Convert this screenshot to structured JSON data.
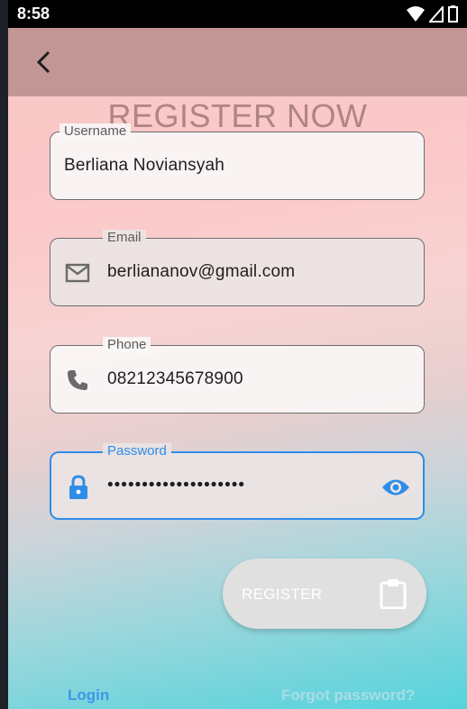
{
  "status_bar": {
    "time": "8:58",
    "icons": [
      "wifi-icon",
      "signal-icon",
      "battery-icon"
    ]
  },
  "app_bar": {
    "back_icon": "back-arrow-icon"
  },
  "page": {
    "title": "REGISTER NOW"
  },
  "form": {
    "username": {
      "label": "Username",
      "value": "Berliana Noviansyah"
    },
    "email": {
      "label": "Email",
      "value": "berliananov@gmail.com",
      "icon": "mail-icon"
    },
    "phone": {
      "label": "Phone",
      "value": "08212345678900",
      "icon": "phone-icon"
    },
    "password": {
      "label": "Password",
      "value": "••••••••••••••••••••",
      "icon": "lock-icon",
      "toggle_icon": "eye-icon",
      "focused": true
    }
  },
  "register_button": {
    "label": "REGISTER",
    "icon": "clipboard-icon"
  },
  "footer": {
    "login_label": "Login",
    "forgot_label": "Forgot password?"
  },
  "colors": {
    "accent": "#2f8de8",
    "link": "#3f97e6",
    "status_bar": "#000000",
    "app_bar": "#966e6e"
  }
}
